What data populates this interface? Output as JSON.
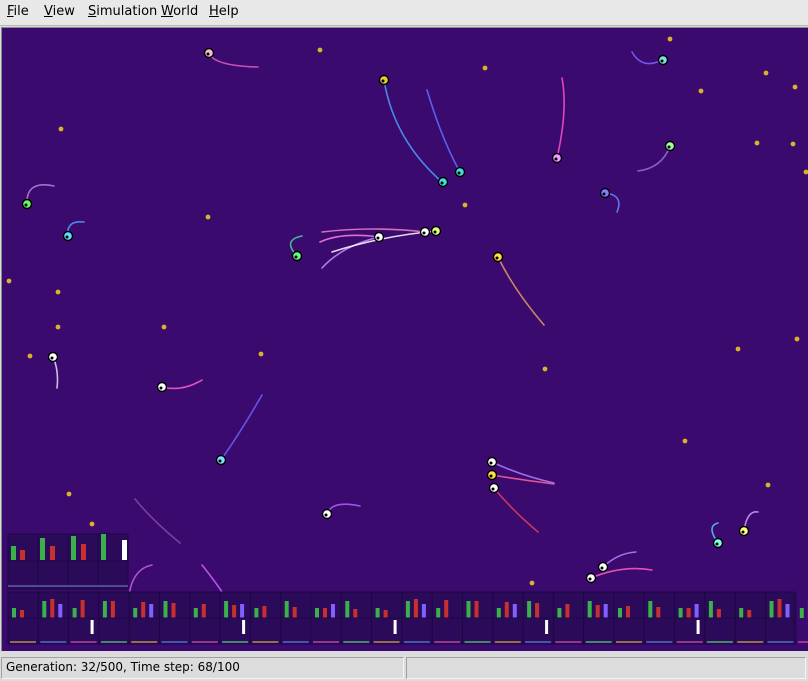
{
  "menubar": {
    "items": [
      {
        "id": "file",
        "mnemonic": "F",
        "rest": "ile"
      },
      {
        "id": "view",
        "mnemonic": "V",
        "rest": "iew"
      },
      {
        "id": "simulation",
        "mnemonic": "S",
        "rest": "imulation"
      },
      {
        "id": "world",
        "mnemonic": "W",
        "rest": "orld"
      },
      {
        "id": "help",
        "mnemonic": "H",
        "rest": "elp"
      }
    ]
  },
  "statusbar": {
    "left_text": "Generation: 32/500, Time step: 68/100",
    "right_text": ""
  },
  "colors": {
    "world_background": "#3a0a6e",
    "food": "#d8b42a",
    "creature_ring": "#000000",
    "chart_panel": "#2c0a5a",
    "bar_green": "#3cb04a",
    "bar_red": "#c83030",
    "bar_white": "#ffffff"
  }
}
